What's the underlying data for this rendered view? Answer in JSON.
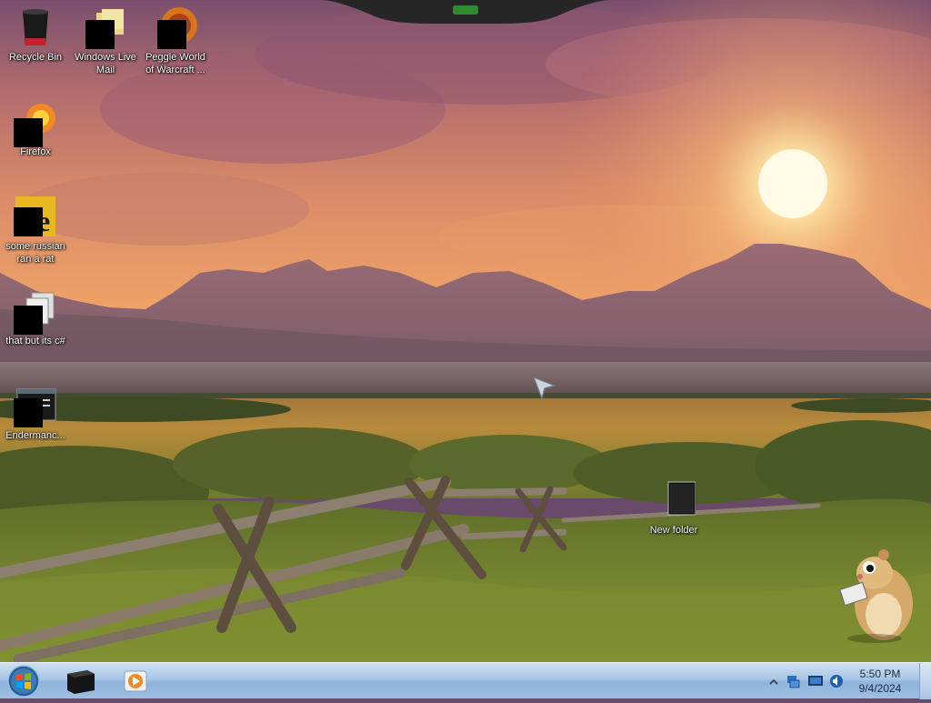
{
  "desktop": {
    "icons": [
      {
        "label": "Recycle Bin",
        "icon": "recycle-bin-icon"
      },
      {
        "label": "Windows Live Mail",
        "icon": "windows-live-mail-icon"
      },
      {
        "label": "Peggle World of Warcraft ...",
        "icon": "peggle-icon"
      },
      {
        "label": "Firefox",
        "icon": "firefox-icon"
      },
      {
        "label": "some russian ran a rat",
        "icon": "rat-file-icon"
      },
      {
        "label": "that but its c#",
        "icon": "shortcut-files-icon"
      },
      {
        "label": "Endermanc...",
        "icon": "console-app-icon"
      },
      {
        "label": "New folder",
        "icon": "folder-icon"
      }
    ]
  },
  "taskbar": {
    "start_icon": "windows-orb-icon",
    "pinned": [
      {
        "name": "app-cube",
        "icon": "black-cube-icon"
      },
      {
        "name": "media-player",
        "icon": "media-player-icon"
      }
    ],
    "tray": {
      "icons": [
        "show-hidden-icons-chevron",
        "network-icon",
        "monitor-icon",
        "volume-icon"
      ],
      "time": "5:50 PM",
      "date": "9/4/2024"
    }
  },
  "colors": {
    "taskbar_top": "#cfe0f0",
    "taskbar_bottom": "#8fb3dc",
    "sky_top": "#8a5a78",
    "sun": "#fff6c8"
  }
}
